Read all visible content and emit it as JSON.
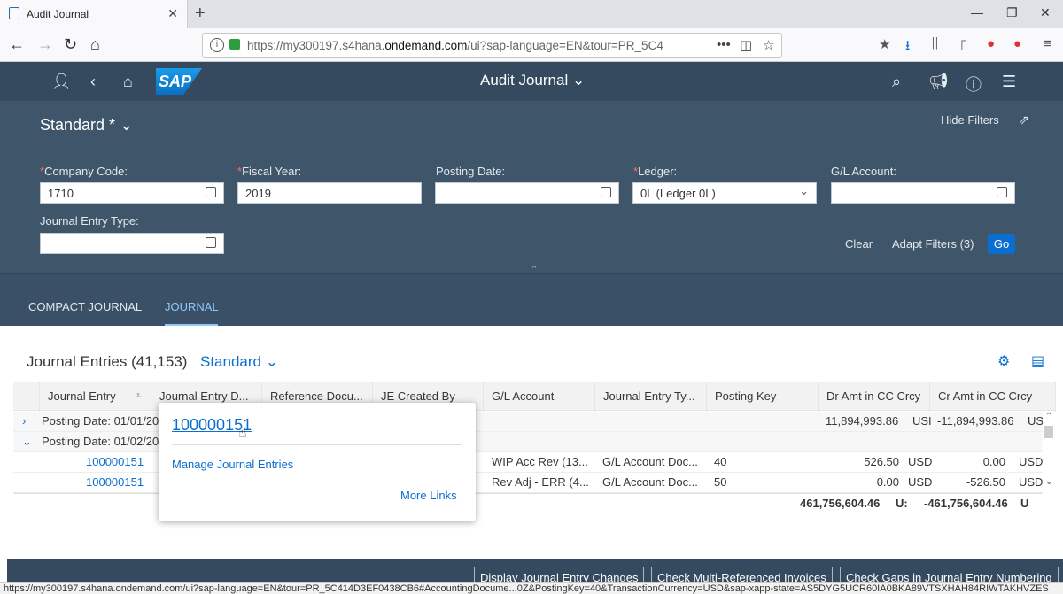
{
  "browser": {
    "tab_title": "Audit Journal",
    "url_prefix": "https://my300197.s4hana.",
    "url_domain": "ondemand.com",
    "url_suffix": "/ui?sap-language=EN&tour=PR_5C414D3EF",
    "status_url": "https://my300197.s4hana.ondemand.com/ui?sap-language=EN&tour=PR_5C414D3EF0438CB6#AccountingDocume...0Z&PostingKey=40&TransactionCurrency=USD&sap-xapp-state=AS5DYG5UCR60IA0BKA89VTSXHAH84RIWTAKHVZES"
  },
  "shell": {
    "title": "Audit Journal"
  },
  "filters": {
    "variant": "Standard *",
    "hide_filters": "Hide Filters",
    "company_code_label": "Company Code:",
    "company_code_value": "1710",
    "fiscal_year_label": "Fiscal Year:",
    "fiscal_year_value": "2019",
    "posting_date_label": "Posting Date:",
    "ledger_label": "Ledger:",
    "ledger_value": "0L (Ledger 0L)",
    "gl_account_label": "G/L Account:",
    "je_type_label": "Journal Entry Type:",
    "clear": "Clear",
    "adapt": "Adapt Filters (3)",
    "go": "Go",
    "required_mark": "*"
  },
  "tabs": {
    "compact": "COMPACT JOURNAL",
    "journal": "JOURNAL"
  },
  "table": {
    "title": "Journal Entries (41,153)",
    "variant": "Standard",
    "columns": [
      "Journal Entry",
      "Journal Entry D...",
      "Reference Docu...",
      "JE Created By",
      "G/L Account",
      "Journal Entry Ty...",
      "Posting Key",
      "Dr Amt in CC Crcy",
      "Cr Amt in CC Crcy"
    ],
    "group1": {
      "label": "Posting Date: 01/01/20",
      "dr": "11,894,993.86",
      "dr_cur": "USI",
      "cr": "-11,894,993.86",
      "cr_cur": "US"
    },
    "group2": {
      "label": "Posting Date: 01/02/20"
    },
    "rows": [
      {
        "je": "100000151",
        "gl": "WIP Acc Rev (13...",
        "jetype": "G/L Account Doc...",
        "pk": "40",
        "dr": "526.50",
        "dr_cur": "USD",
        "cr": "0.00",
        "cr_cur": "USD"
      },
      {
        "je": "100000151",
        "gl": "Rev Adj - ERR (4...",
        "jetype": "G/L Account Doc...",
        "pk": "50",
        "dr": "0.00",
        "dr_cur": "USD",
        "cr": "-526.50",
        "cr_cur": "USD"
      }
    ],
    "total": {
      "dr": "461,756,604.46",
      "dr_cur": "U:",
      "cr": "-461,756,604.46",
      "cr_cur": "U"
    }
  },
  "popover": {
    "title": "100000151",
    "link1": "Manage Journal Entries",
    "more": "More Links"
  },
  "footer": {
    "btn1": "Display Journal Entry Changes",
    "btn2": "Check Multi-Referenced Invoices",
    "btn3": "Check Gaps in Journal Entry Numbering"
  }
}
